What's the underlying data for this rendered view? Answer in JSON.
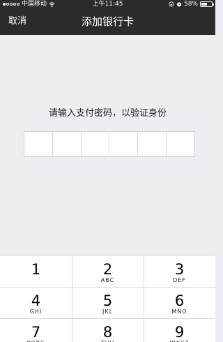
{
  "status_bar": {
    "carrier": "中国移动",
    "time": "上午11:45",
    "battery": "58%",
    "battery_level": 0.58,
    "icons": [
      "signal-dots-icon",
      "wifi-icon",
      "rotation-lock-icon",
      "alarm-icon",
      "battery-icon"
    ]
  },
  "nav": {
    "cancel_label": "取消",
    "title": "添加银行卡"
  },
  "prompt": "请输入支付密码，以验证身份",
  "pin_length": 6,
  "keypad": {
    "keys": [
      {
        "digit": "1",
        "letters": ""
      },
      {
        "digit": "2",
        "letters": "ABC"
      },
      {
        "digit": "3",
        "letters": "DEF"
      },
      {
        "digit": "4",
        "letters": "GHI"
      },
      {
        "digit": "5",
        "letters": "JKL"
      },
      {
        "digit": "6",
        "letters": "MNO"
      },
      {
        "digit": "7",
        "letters": "PQRS"
      },
      {
        "digit": "8",
        "letters": "TUV"
      },
      {
        "digit": "9",
        "letters": "WXYZ"
      }
    ]
  },
  "colors": {
    "nav_background": "#2b2b2b",
    "page_background": "#efedf2",
    "pin_border": "#c4d0e8"
  }
}
